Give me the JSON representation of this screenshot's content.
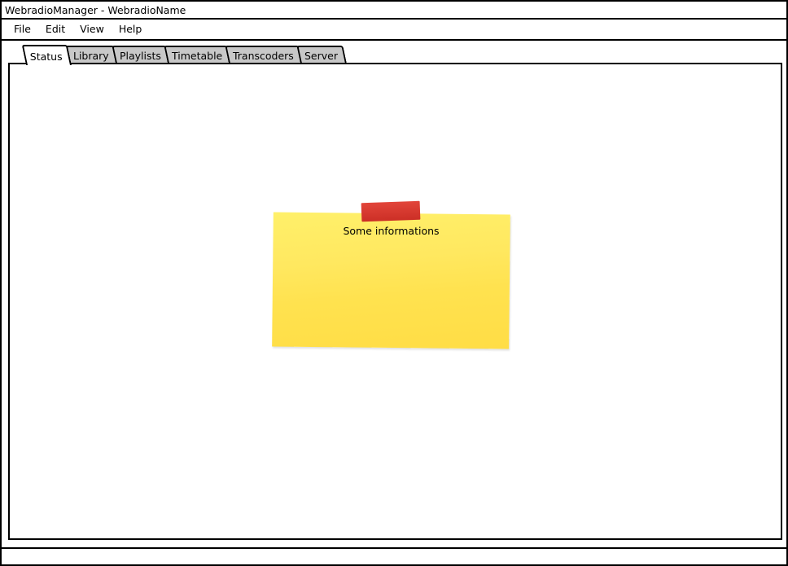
{
  "window": {
    "title": "WebradioManager - WebradioName"
  },
  "menubar": {
    "items": [
      {
        "label": "File"
      },
      {
        "label": "Edit"
      },
      {
        "label": "View"
      },
      {
        "label": "Help"
      }
    ]
  },
  "tabs": {
    "items": [
      {
        "label": "Status",
        "active": true
      },
      {
        "label": "Library"
      },
      {
        "label": "Playlists"
      },
      {
        "label": "Timetable"
      },
      {
        "label": "Transcoders"
      },
      {
        "label": "Server"
      }
    ]
  },
  "status_panel": {
    "note": {
      "text": "Some informations",
      "color": "#ffe35a",
      "tape_color": "#d63a30"
    }
  }
}
